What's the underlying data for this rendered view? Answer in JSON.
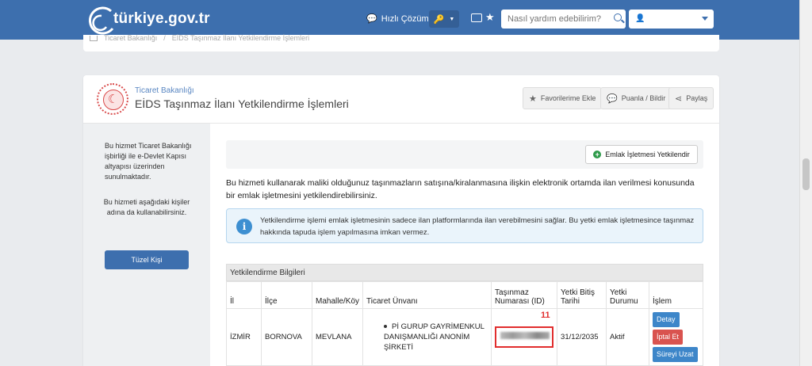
{
  "header": {
    "logo_text": "türkiye.gov.tr",
    "quick_solution": "Hızlı Çözüm",
    "search_placeholder": "Nasıl yardım edebilirim?"
  },
  "breadcrumb": {
    "items": [
      "Ticaret Bakanlığı",
      "EİDS Taşınmaz İlanı Yetkilendirme İşlemleri"
    ]
  },
  "service": {
    "ministry": "Ticaret Bakanlığı",
    "title": "EİDS Taşınmaz İlanı Yetkilendirme İşlemleri",
    "actions": {
      "favorite": "Favorilerime Ekle",
      "rate": "Puanla / Bildir",
      "share": "Paylaş"
    }
  },
  "sidebar": {
    "text1": "Bu hizmet Ticaret Bakanlığı işbirliği ile e-Devlet Kapısı altyapısı üzerinden sunulmaktadır.",
    "text2": "Bu hizmeti aşağıdaki kişiler adına da kullanabilirsiniz.",
    "button": "Tüzel Kişi"
  },
  "content": {
    "emlak_button": "Emlak İşletmesi Yetkilendir",
    "description": "Bu hizmeti kullanarak maliki olduğunuz taşınmazların satışına/kiralanmasına ilişkin elektronik ortamda ilan verilmesi konusunda bir emlak işletmesini yetkilendirebilirsiniz.",
    "info": "Yetkilendirme işlemi emlak işletmesinin sadece ilan platformlarında ilan verebilmesini sağlar. Bu yetki emlak işletmesince taşınmaz hakkında tapuda işlem yapılmasına imkan vermez."
  },
  "table": {
    "title": "Yetkilendirme Bilgileri",
    "columns": [
      "İl",
      "İlçe",
      "Mahalle/Köy",
      "Ticaret Ünvanı",
      "Taşınmaz Numarası (ID)",
      "Yetki Bitiş Tarihi",
      "Yetki Durumu",
      "İşlem"
    ],
    "rows": [
      {
        "il": "İZMİR",
        "ilce": "BORNOVA",
        "mahalle": "MEVLANA",
        "unvan": "Pİ GURUP GAYRİMENKUL DANIŞMANLIĞI ANONİM ŞİRKETİ",
        "bitis": "31/12/2035",
        "durum": "Aktif",
        "ops": [
          "Detay",
          "İptal Et",
          "Süreyi Uzat"
        ]
      }
    ],
    "annotation": "11"
  }
}
